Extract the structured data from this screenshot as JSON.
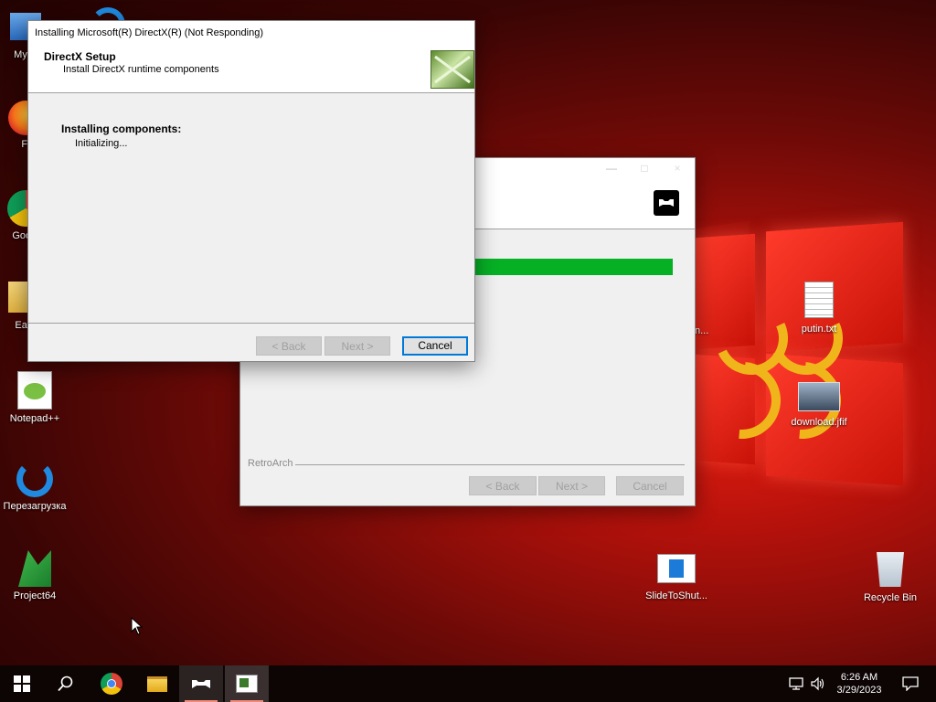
{
  "desktop": {
    "icons": [
      {
        "label": "My C",
        "icon": "my-computer-icon"
      },
      {
        "label": "Fi",
        "icon": "firefox-icon"
      },
      {
        "label": "Googl",
        "icon": "google-chrome-icon"
      },
      {
        "label": "Earn",
        "icon": "folder-icon"
      },
      {
        "label": "Notepad++",
        "icon": "notepad-plus-plus-icon"
      },
      {
        "label": "Перезагрузка",
        "icon": "refresh-icon"
      },
      {
        "label": "Project64",
        "icon": "project64-icon"
      },
      {
        "label": "putin.txt",
        "icon": "text-file-icon"
      },
      {
        "label": "download.jfif",
        "icon": "image-file-icon"
      },
      {
        "label": "SlideToShut...",
        "icon": "shortcut-icon"
      },
      {
        "label": "Recycle Bin",
        "icon": "recycle-bin-icon"
      }
    ],
    "partial_label_behind": "n..."
  },
  "retroarch_window": {
    "footer_label": "RetroArch",
    "progress": 1.0,
    "progress_color": "#06b025",
    "buttons": {
      "back": "< Back",
      "next": "Next >",
      "cancel": "Cancel"
    }
  },
  "directx_window": {
    "title": "Installing Microsoft(R) DirectX(R) (Not Responding)",
    "header_title": "DirectX Setup",
    "header_subtitle": "Install DirectX runtime components",
    "status_heading": "Installing components:",
    "status_detail": "Initializing...",
    "buttons": {
      "back": "< Back",
      "next": "Next >",
      "cancel": "Cancel"
    }
  },
  "taskbar": {
    "items": [
      "start-icon",
      "search-icon",
      "chrome-icon",
      "file-explorer-icon",
      "retroarch-icon",
      "directx-setup-icon"
    ],
    "time": "6:26 AM",
    "date": "3/29/2023"
  },
  "colors": {
    "accent": "#0078d7",
    "desktop_red": "#c81208",
    "hammer_sickle": "#f0b51b"
  }
}
